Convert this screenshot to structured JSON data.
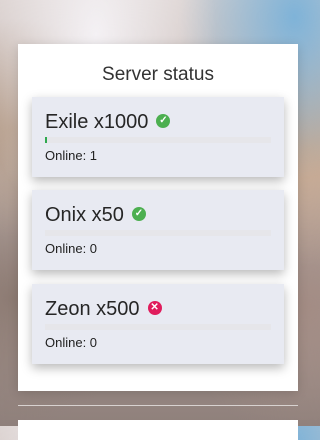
{
  "panel": {
    "title": "Server status"
  },
  "servers": [
    {
      "name": "Exile x1000",
      "status": "online",
      "status_icon": "check-circle-icon",
      "online_label": "Online: 1",
      "fill_fraction": 0.005
    },
    {
      "name": "Onix x50",
      "status": "online",
      "status_icon": "check-circle-icon",
      "online_label": "Online: 0",
      "fill_fraction": 0
    },
    {
      "name": "Zeon x500",
      "status": "offline",
      "status_icon": "x-circle-icon",
      "online_label": "Online: 0",
      "fill_fraction": 0
    }
  ],
  "colors": {
    "online": "#4caf50",
    "offline": "#e01c5c",
    "bar_fill": "#2fa84f"
  }
}
